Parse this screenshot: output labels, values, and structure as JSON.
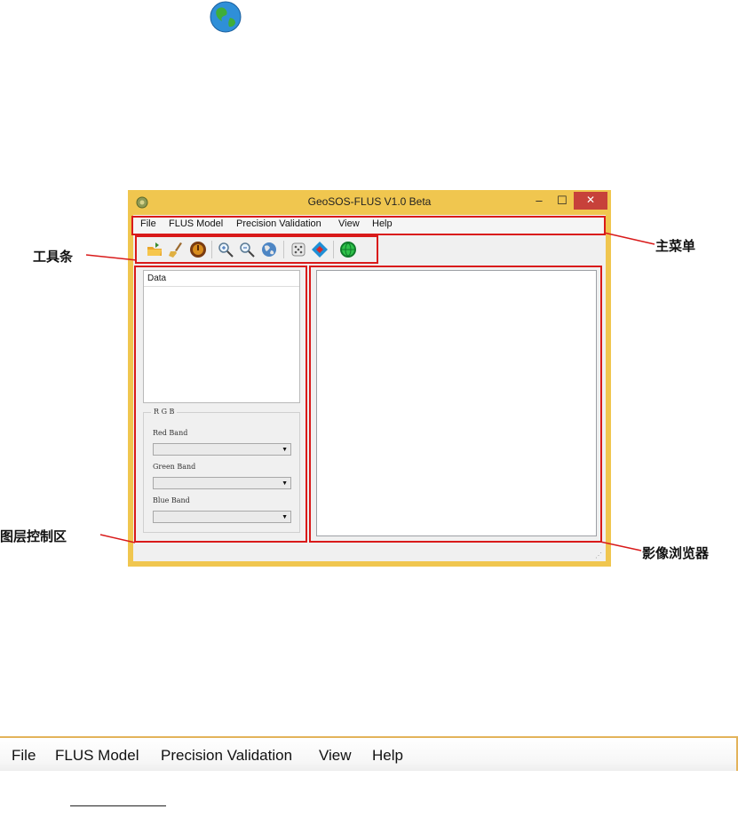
{
  "window": {
    "title": "GeoSOS-FLUS V1.0 Beta",
    "min_glyph": "–",
    "max_glyph": "☐",
    "close_glyph": "✕"
  },
  "menu": {
    "items": [
      "File",
      "FLUS Model",
      "Precision Validation",
      "View",
      "Help"
    ]
  },
  "toolbar": {
    "icons": [
      "open-folder-icon",
      "broom-clear-icon",
      "stop-icon",
      "zoom-in-icon",
      "zoom-out-icon",
      "globe-full-extent-icon",
      "dice-icon",
      "diamond-map-icon",
      "green-globe-icon"
    ]
  },
  "layer_panel": {
    "data_header": "Data",
    "rgb_title": "R G B",
    "red_label": "Red   Band",
    "green_label": "Green Band",
    "blue_label": "Blue  Band",
    "dropdown_arrow": "▼"
  },
  "annotations": {
    "toolbar": "工具条",
    "main_menu": "主菜单",
    "layer_control": "图层控制区",
    "image_viewer": "影像浏览器"
  },
  "zoom_menu": {
    "items": [
      "File",
      "FLUS Model",
      "Precision Validation",
      "View",
      "Help"
    ]
  },
  "status": {
    "grip": "⋰"
  },
  "colors": {
    "window_frame": "#f0c64f",
    "annotation_red": "#d91a1a",
    "close_button": "#c7413a"
  }
}
